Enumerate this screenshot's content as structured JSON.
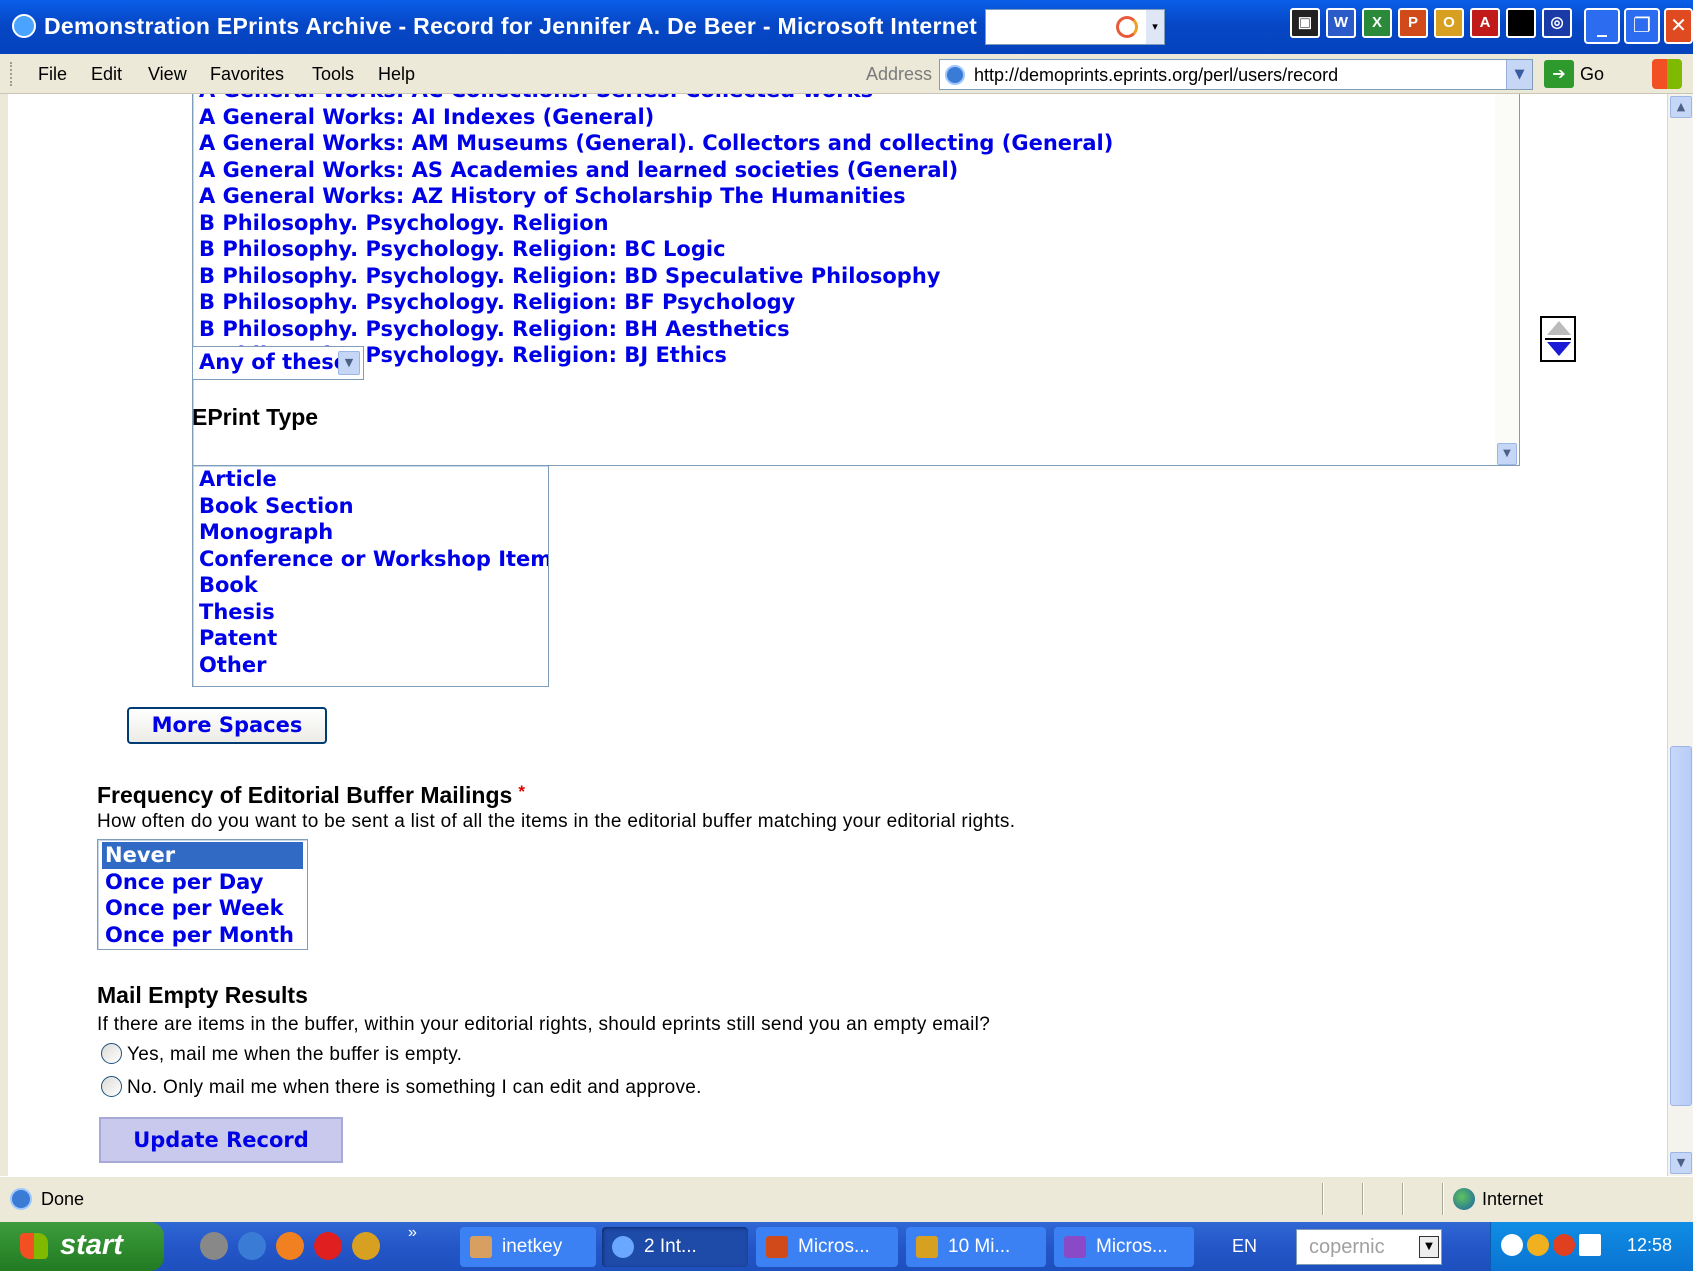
{
  "window": {
    "title": "Demonstration EPrints Archive - Record for Jennifer A. De Beer - Microsoft Internet Explo"
  },
  "menubar": {
    "items": [
      "File",
      "Edit",
      "View",
      "Favorites",
      "Tools",
      "Help"
    ],
    "address_label": "Address",
    "address_url": "http://demoprints.eprints.org/perl/users/record",
    "go_label": "Go"
  },
  "subjects": {
    "items": [
      "A General Works: AC Collections. Series. Collected works",
      "A General Works: AI Indexes (General)",
      "A General Works: AM Museums (General). Collectors and collecting (General)",
      "A General Works: AS Academies and learned societies (General)",
      "A General Works: AZ History of Scholarship The Humanities",
      "B Philosophy. Psychology. Religion",
      "B Philosophy. Psychology. Religion: BC Logic",
      "B Philosophy. Psychology. Religion: BD Speculative Philosophy",
      "B Philosophy. Psychology. Religion: BF Psychology",
      "B Philosophy. Psychology. Religion: BH Aesthetics",
      "B Philosophy. Psychology. Religion: BJ Ethics"
    ],
    "match_mode": "Any of these"
  },
  "eprint_type": {
    "heading": "EPrint Type",
    "items": [
      "Article",
      "Book Section",
      "Monograph",
      "Conference or Workshop Item",
      "Book",
      "Thesis",
      "Patent",
      "Other"
    ]
  },
  "more_spaces_label": "More Spaces",
  "frequency": {
    "heading": "Frequency of Editorial Buffer Mailings",
    "required_mark": "*",
    "help": "How often do you want to be sent a list of all the items in the editorial buffer matching your editorial rights.",
    "options": [
      "Never",
      "Once per Day",
      "Once per Week",
      "Once per Month"
    ],
    "selected": "Never"
  },
  "mail_empty": {
    "heading": "Mail Empty Results",
    "help": "If there are items in the buffer, within your editorial rights, should eprints still send you an empty email?",
    "options": [
      "Yes, mail me when the buffer is empty.",
      "No. Only mail me when there is something I can edit and approve."
    ]
  },
  "update_label": "Update Record",
  "statusbar": {
    "status": "Done",
    "zone": "Internet"
  },
  "taskbar": {
    "start": "start",
    "tasks": [
      "inetkey",
      "2 Int...",
      "Micros...",
      "10 Mi...",
      "Micros..."
    ],
    "language": "EN",
    "search_placeholder": "copernic",
    "clock": "12:58"
  },
  "colors": {
    "link_blue": "#0000e6",
    "selected_bg": "#316ac5",
    "titlebar_blue": "#0647c6",
    "required_red": "#dd0000"
  }
}
